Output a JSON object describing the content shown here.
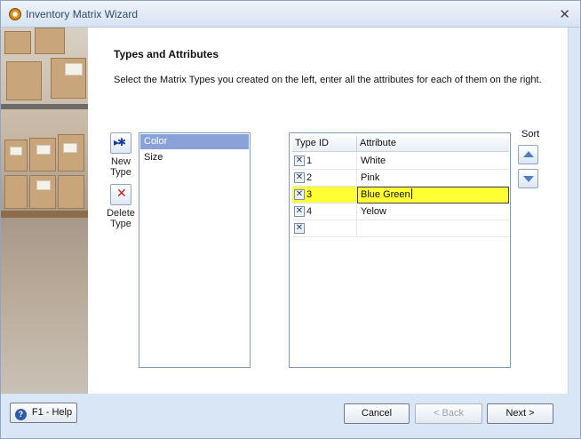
{
  "window": {
    "title": "Inventory Matrix Wizard"
  },
  "page": {
    "heading": "Types and Attributes",
    "instructions": "Select the Matrix Types you created on the left, enter all the attributes for each of them on the right."
  },
  "tools": {
    "new_type_label": [
      "New",
      "Type"
    ],
    "delete_type_label": [
      "Delete",
      "Type"
    ]
  },
  "types": [
    {
      "label": "Color",
      "selected": true
    },
    {
      "label": "Size",
      "selected": false
    }
  ],
  "grid": {
    "columns": [
      "Type ID",
      "Attribute"
    ],
    "rows": [
      {
        "id": "1",
        "attribute": "White"
      },
      {
        "id": "2",
        "attribute": "Pink"
      },
      {
        "id": "3",
        "attribute": "Blue Green"
      },
      {
        "id": "4",
        "attribute": "Yelow"
      },
      {
        "id": "",
        "attribute": ""
      }
    ],
    "editing_row": 2,
    "highlight_color": "#ffff33"
  },
  "sort": {
    "label": "Sort"
  },
  "buttons": {
    "help": "F1 - Help",
    "cancel": "Cancel",
    "back": "< Back",
    "next": "Next >"
  },
  "icons": {
    "app": "wizard-app-icon",
    "close": "close-icon",
    "new_type": "new-type-icon",
    "delete_type": "delete-icon",
    "row_delete": "row-delete-icon",
    "sort_up": "arrow-up-icon",
    "sort_down": "arrow-down-icon",
    "help": "help-icon"
  }
}
